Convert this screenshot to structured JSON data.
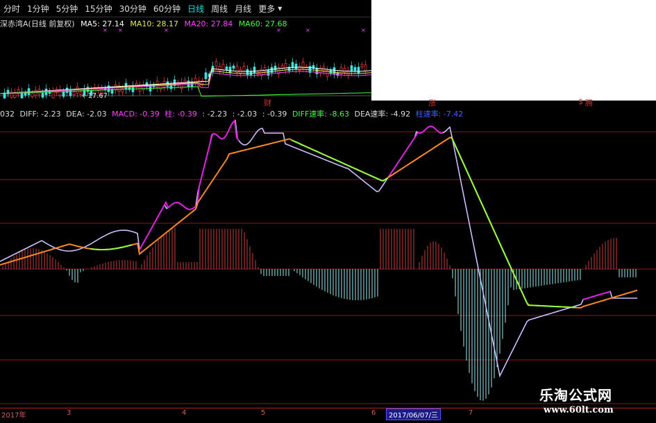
{
  "tabs": [
    {
      "label": "分时",
      "active": false
    },
    {
      "label": "1分钟",
      "active": false
    },
    {
      "label": "5分钟",
      "active": false
    },
    {
      "label": "15分钟",
      "active": false
    },
    {
      "label": "30分钟",
      "active": false
    },
    {
      "label": "60分钟",
      "active": false
    },
    {
      "label": "日线",
      "active": true
    },
    {
      "label": "周线",
      "active": false
    },
    {
      "label": "月线",
      "active": false
    },
    {
      "label": "更多",
      "active": false
    }
  ],
  "more_arrow": "▾",
  "price_legend": {
    "stock": "深赤湾A(日线 前复权)",
    "ma5": "MA5: 27.14",
    "ma10": "MA10: 28.17",
    "ma20": "MA20: 27.84",
    "ma60": "MA60: 27.68"
  },
  "low_price_label": "←17.67",
  "event_marks": [
    {
      "label": "财",
      "color": "#cc3333"
    },
    {
      "label": "涨",
      "color": "#cc3333"
    },
    {
      "label": "$",
      "color": "#cc3333"
    },
    {
      "label": "腾",
      "color": "#cc3333"
    }
  ],
  "macd_legend": {
    "code": "032",
    "diff": "DIFF: -2.23",
    "dea": "DEA: -2.03",
    "macd": "MACD: -0.39",
    "zhu": "柱: -0.39",
    "v1": ": -2.23",
    "v2": ": -2.03",
    "v3": ": -0.39",
    "diff_speed": "DIFF速率: -8.63",
    "dea_speed": "DEA速率: -4.92",
    "zhu_speed": "柱速率: -7.42"
  },
  "time_axis": {
    "labels": [
      "2017年",
      "3",
      "4",
      "5",
      "6",
      "7"
    ],
    "selected_date": "2017/06/07/三"
  },
  "watermark": {
    "title": "乐淘公式网",
    "url": "www.60lt.com"
  },
  "colors": {
    "diff_magenta": "#e020e0",
    "diff_lavender": "#c8c0ff",
    "dea_orange": "#ff8a20",
    "dea_green": "#90ff40",
    "hist_red": "#c84040",
    "hist_cyan": "#9cf0f0",
    "grid_red": "#8a1a1a",
    "ma5": "#ffffff",
    "ma10": "#e8e850",
    "ma20": "#ff40ff",
    "ma60": "#40ff40"
  },
  "chart_data": {
    "type": "line",
    "series": [
      {
        "name": "DIFF",
        "values": [
          -2.23
        ]
      },
      {
        "name": "DEA",
        "values": [
          -2.03
        ]
      },
      {
        "name": "MACD",
        "values": [
          -0.39
        ]
      }
    ]
  }
}
